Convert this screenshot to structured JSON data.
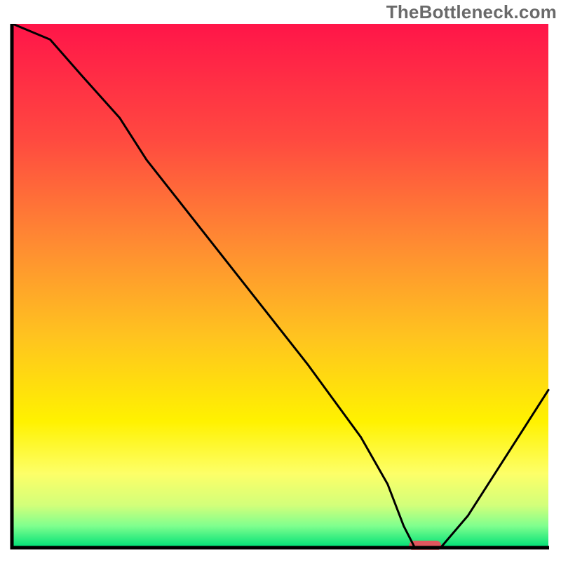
{
  "watermark": "TheBottleneck.com",
  "chart_data": {
    "type": "line",
    "title": "",
    "xlabel": "",
    "ylabel": "",
    "x": [
      0,
      7,
      13,
      20,
      25,
      30,
      35,
      40,
      45,
      50,
      55,
      60,
      65,
      70,
      73,
      75,
      77,
      80,
      85,
      90,
      95,
      100
    ],
    "values": [
      102,
      97,
      90,
      82,
      74,
      67.5,
      61,
      54.5,
      48,
      41.5,
      35,
      28,
      21,
      12,
      4,
      0,
      0,
      0,
      6,
      14,
      22,
      30
    ],
    "ylim": [
      0,
      100
    ],
    "xlim": [
      0,
      100
    ],
    "gradient_stops": [
      {
        "offset": 0.0,
        "color": "#ff1549"
      },
      {
        "offset": 0.22,
        "color": "#ff4940"
      },
      {
        "offset": 0.42,
        "color": "#ff8b32"
      },
      {
        "offset": 0.6,
        "color": "#ffc41f"
      },
      {
        "offset": 0.76,
        "color": "#fff200"
      },
      {
        "offset": 0.86,
        "color": "#fdff68"
      },
      {
        "offset": 0.92,
        "color": "#d3ff7a"
      },
      {
        "offset": 0.96,
        "color": "#7fff8e"
      },
      {
        "offset": 1.0,
        "color": "#00e077"
      }
    ],
    "marker": {
      "x": 77,
      "y": 0,
      "width_pct": 6,
      "color": "#e0575e"
    },
    "axis_color": "#000000",
    "line_color": "#000000"
  }
}
